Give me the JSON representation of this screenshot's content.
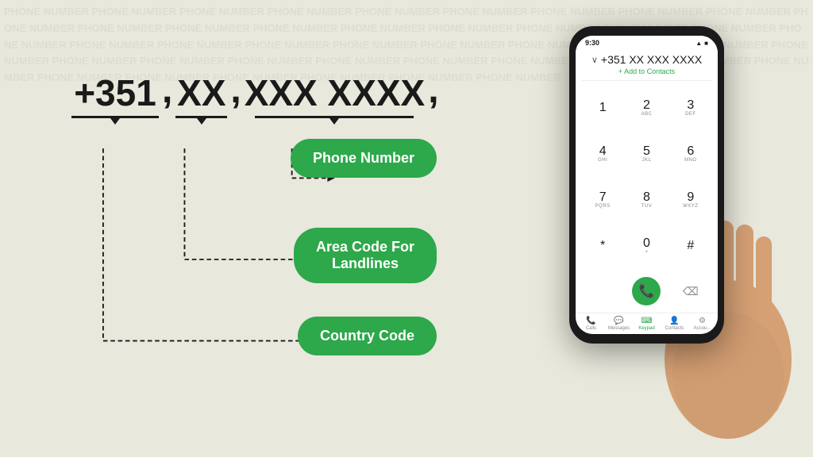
{
  "background": {
    "color": "#e8e8dc"
  },
  "phone_display": {
    "country_code": "+351",
    "area_code": "XX",
    "number": "XXX XXXX",
    "separator": ","
  },
  "labels": {
    "phone_number": "Phone Number",
    "area_code": "Area Code For\nLandlines",
    "country_code": "Country Code"
  },
  "phone_mockup": {
    "status_bar": {
      "time": "9:30",
      "signal": "▲",
      "battery": "■"
    },
    "dial_number": "∨ +351  XX XXX XXXX",
    "add_to_contacts": "Add to Contacts",
    "keypad": [
      {
        "num": "1",
        "letters": ""
      },
      {
        "num": "2",
        "letters": "ABC"
      },
      {
        "num": "3",
        "letters": "DEF"
      },
      {
        "num": "4",
        "letters": "GHI"
      },
      {
        "num": "5",
        "letters": "JKL"
      },
      {
        "num": "6",
        "letters": "MNO"
      },
      {
        "num": "7",
        "letters": "PQRS"
      },
      {
        "num": "8",
        "letters": "TUV"
      },
      {
        "num": "9",
        "letters": "WXYZ"
      },
      {
        "num": "*",
        "letters": ""
      },
      {
        "num": "0",
        "letters": "+"
      },
      {
        "num": "#",
        "letters": ""
      }
    ],
    "nav_items": [
      {
        "label": "Calls",
        "icon": "📞",
        "active": false
      },
      {
        "label": "Messages",
        "icon": "💬",
        "active": false
      },
      {
        "label": "Keypad",
        "icon": "⌨",
        "active": true
      },
      {
        "label": "Contacts",
        "icon": "👤",
        "active": false
      },
      {
        "label": "Accou...",
        "icon": "⚙",
        "active": false
      }
    ]
  }
}
